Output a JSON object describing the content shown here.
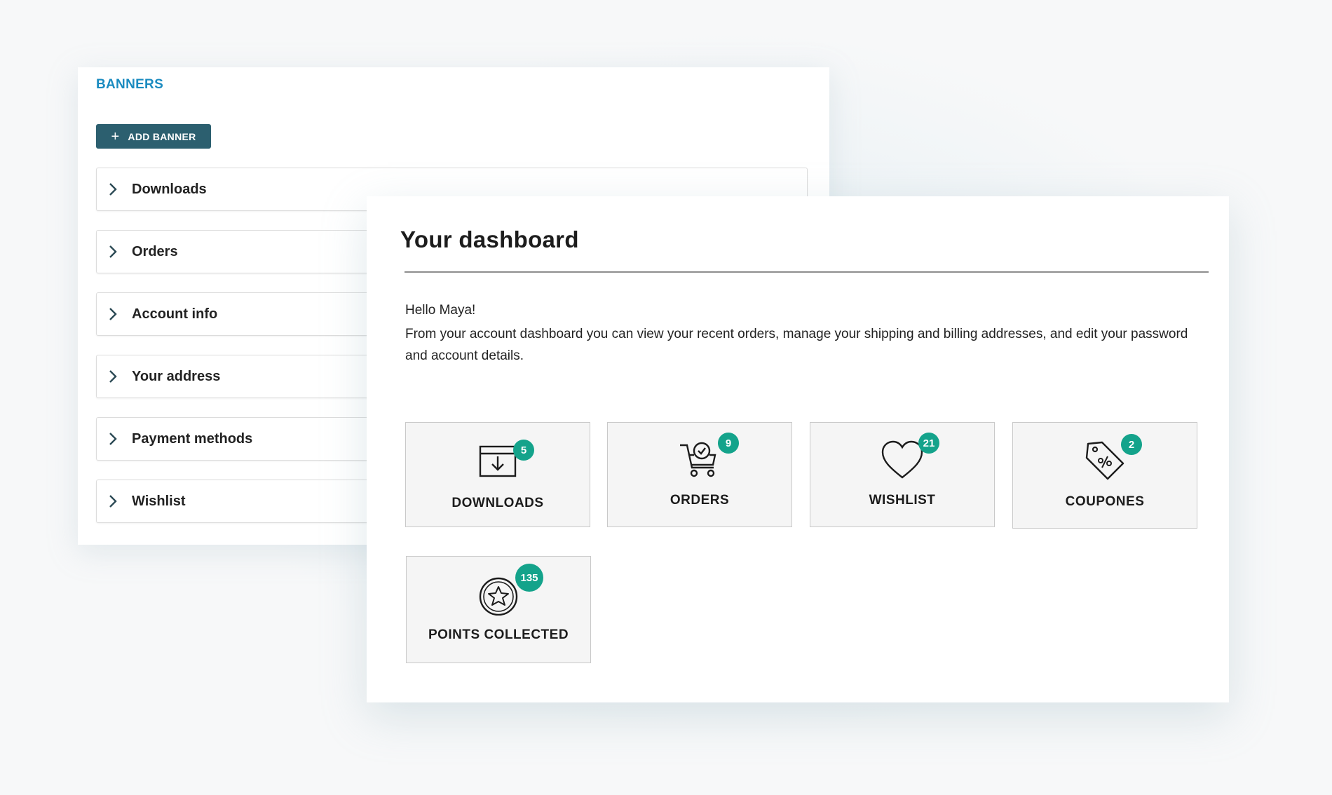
{
  "banners": {
    "title": "BANNERS",
    "add_button_label": "ADD BANNER",
    "items": [
      {
        "label": "Downloads"
      },
      {
        "label": "Orders"
      },
      {
        "label": "Account info"
      },
      {
        "label": "Your address"
      },
      {
        "label": "Payment methods"
      },
      {
        "label": "Wishlist"
      }
    ]
  },
  "dashboard": {
    "title": "Your dashboard",
    "greeting": "Hello Maya!",
    "description": "From your account dashboard you can view your recent orders, manage your shipping and billing addresses, and edit your password and account details.",
    "tiles": [
      {
        "label": "DOWNLOADS",
        "count": "5",
        "icon": "download-box-icon"
      },
      {
        "label": "ORDERS",
        "count": "9",
        "icon": "cart-icon"
      },
      {
        "label": "WISHLIST",
        "count": "21",
        "icon": "heart-icon"
      },
      {
        "label": "COUPONES",
        "count": "2",
        "icon": "coupon-tag-icon"
      },
      {
        "label": "POINTS COLLECTED",
        "count": "135",
        "icon": "star-coin-icon"
      }
    ]
  },
  "colors": {
    "accent_blue": "#1a8bc0",
    "button_bg": "#2c5f6f",
    "badge_green": "#14a38b"
  }
}
